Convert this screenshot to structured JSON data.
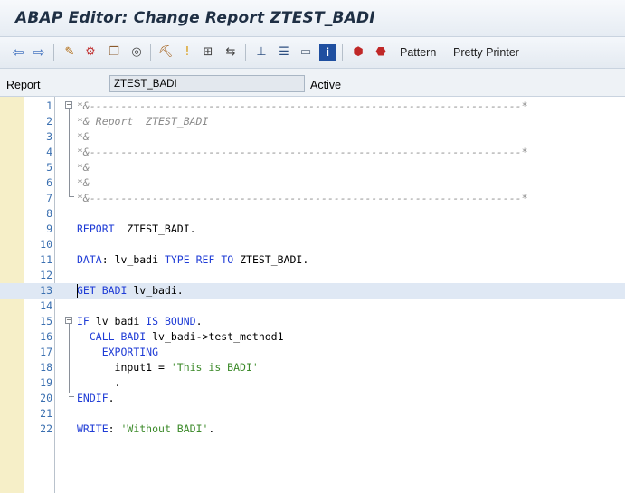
{
  "window": {
    "title": "ABAP Editor: Change Report ZTEST_BADI"
  },
  "toolbar": {
    "pattern_label": "Pattern",
    "pretty_printer_label": "Pretty Printer"
  },
  "report_row": {
    "label": "Report",
    "value": "ZTEST_BADI",
    "status": "Active"
  },
  "editor": {
    "current_line": 13,
    "lines": [
      {
        "n": "1",
        "t": "*&---------------------------------------------------------------------*"
      },
      {
        "n": "2",
        "t": "*& Report  ZTEST_BADI"
      },
      {
        "n": "3",
        "t": "*&"
      },
      {
        "n": "4",
        "t": "*&---------------------------------------------------------------------*"
      },
      {
        "n": "5",
        "t": "*&"
      },
      {
        "n": "6",
        "t": "*&"
      },
      {
        "n": "7",
        "t": "*&---------------------------------------------------------------------*"
      },
      {
        "n": "8",
        "t": ""
      },
      {
        "n": "9",
        "t": "REPORT  ZTEST_BADI."
      },
      {
        "n": "10",
        "t": ""
      },
      {
        "n": "11",
        "t": "DATA: lv_badi TYPE REF TO ZTEST_BADI."
      },
      {
        "n": "12",
        "t": ""
      },
      {
        "n": "13",
        "t": "GET BADI lv_badi."
      },
      {
        "n": "14",
        "t": ""
      },
      {
        "n": "15",
        "t": "IF lv_badi IS BOUND."
      },
      {
        "n": "16",
        "t": "  CALL BADI lv_badi->test_method1"
      },
      {
        "n": "17",
        "t": "    EXPORTING"
      },
      {
        "n": "18",
        "t": "      input1 = 'This is BADI'"
      },
      {
        "n": "19",
        "t": "      ."
      },
      {
        "n": "20",
        "t": "ENDIF."
      },
      {
        "n": "21",
        "t": ""
      },
      {
        "n": "22",
        "t": "WRITE: 'Without BADI'."
      }
    ]
  },
  "colors": {
    "keyword": "#1f3cd6",
    "comment": "#8a8a8a",
    "string": "#3c8a2a",
    "line_number": "#3a6fb0",
    "current_line_bg": "#dfe8f4"
  }
}
